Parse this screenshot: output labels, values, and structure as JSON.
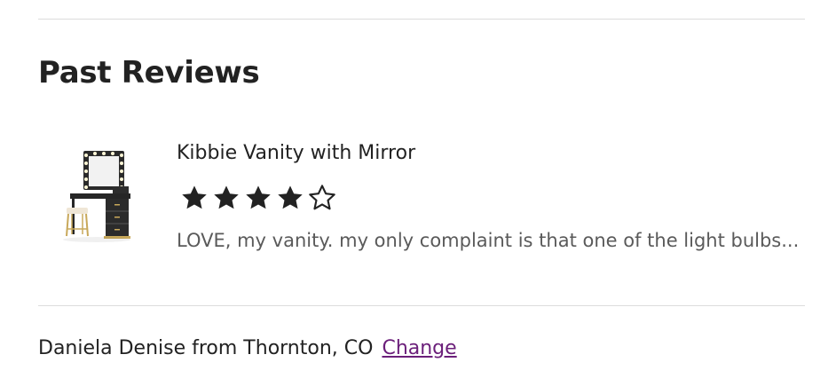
{
  "section_title": "Past Reviews",
  "reviews": [
    {
      "product_name": "Kibbie Vanity with Mirror",
      "rating": 4,
      "rating_max": 5,
      "excerpt": "LOVE, my vanity. my only complaint is that one of the light bulbs..."
    }
  ],
  "location": {
    "text": "Daniela Denise from Thornton, CO",
    "change_label": "Change"
  },
  "colors": {
    "text": "#222222",
    "muted_text": "#5a5a5a",
    "link": "#6b1f7a",
    "divider": "#dcdcdc",
    "star_fill": "#222222"
  },
  "icons": {
    "filled_star": "star-filled-icon",
    "empty_star": "star-empty-icon"
  }
}
